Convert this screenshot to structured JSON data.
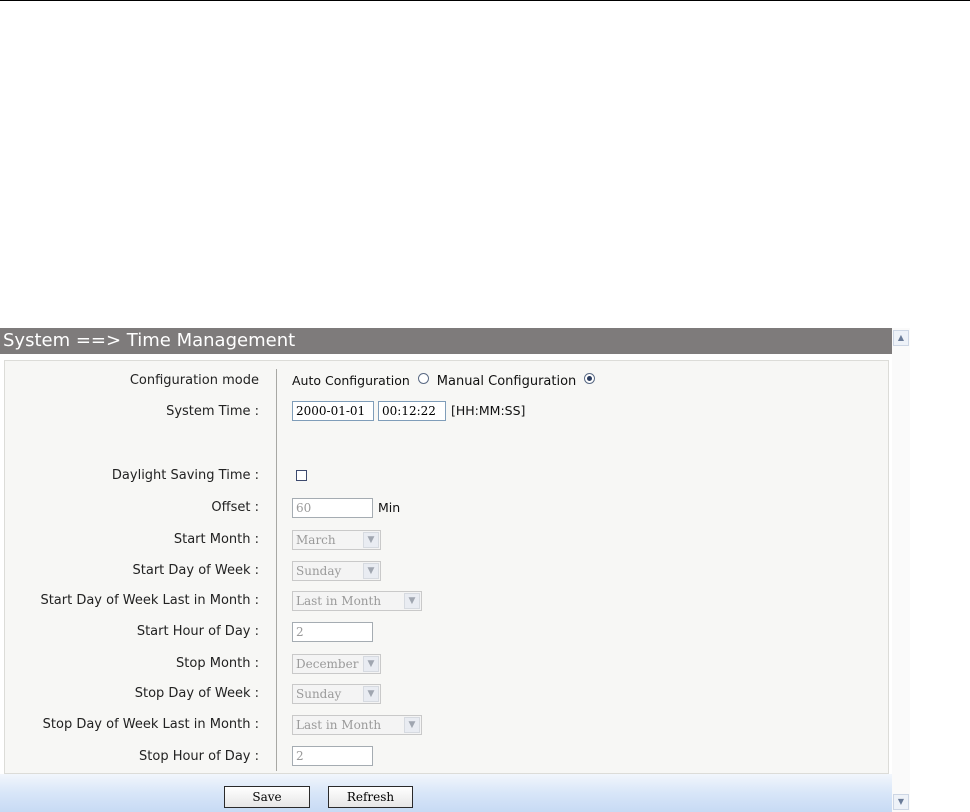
{
  "panel": {
    "title": "System ==> Time Management"
  },
  "form": {
    "config_mode": {
      "label": "Configuration mode",
      "options": [
        {
          "label": "Auto Configuration",
          "selected": false
        },
        {
          "label": "Manual Configuration",
          "selected": true
        }
      ]
    },
    "system_time": {
      "label": "System Time :",
      "date": "2000-01-01",
      "time": "00:12:22",
      "format": "[HH:MM:SS]"
    },
    "dst": {
      "label": "Daylight Saving Time :",
      "checked": false
    },
    "offset": {
      "label": "Offset :",
      "value": "60",
      "unit": "Min"
    },
    "start_month": {
      "label": "Start Month :",
      "value": "March"
    },
    "start_dow": {
      "label": "Start Day of Week :",
      "value": "Sunday"
    },
    "start_dow_last": {
      "label": "Start Day of Week Last in Month :",
      "value": "Last in Month"
    },
    "start_hour": {
      "label": "Start Hour of Day :",
      "value": "2"
    },
    "stop_month": {
      "label": "Stop Month :",
      "value": "December"
    },
    "stop_dow": {
      "label": "Stop Day of Week :",
      "value": "Sunday"
    },
    "stop_dow_last": {
      "label": "Stop Day of Week Last in Month :",
      "value": "Last in Month"
    },
    "stop_hour": {
      "label": "Stop Hour of Day :",
      "value": "2"
    }
  },
  "buttons": {
    "save": "Save",
    "refresh": "Refresh"
  },
  "icons": {
    "scroll_up": "scroll-up-arrow-icon",
    "scroll_down": "scroll-down-arrow-icon",
    "dropdown": "chevron-down-icon"
  },
  "colors": {
    "title_bar": "#7e7b7b",
    "footer": "#d8e6f8"
  }
}
